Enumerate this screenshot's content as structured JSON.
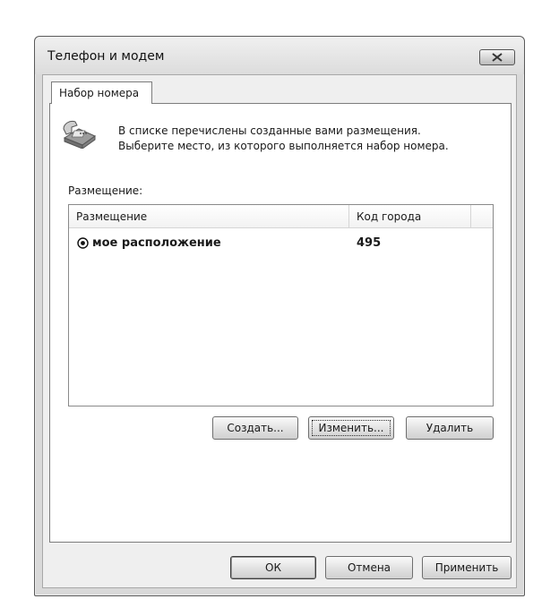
{
  "window": {
    "title": "Телефон и модем"
  },
  "tabs": [
    {
      "label": "Набор номера",
      "active": true
    }
  ],
  "panel": {
    "intro_line1": "В списке перечислены созданные вами размещения.",
    "intro_line2": "Выберите место, из которого выполняется набор номера.",
    "list_label": "Размещение:",
    "columns": [
      "Размещение",
      "Код города"
    ],
    "rows": [
      {
        "name": "мое расположение",
        "code": "495",
        "selected": true
      }
    ],
    "buttons": {
      "create": "Создать...",
      "edit": "Изменить...",
      "delete": "Удалить"
    }
  },
  "footer": {
    "ok": "ОК",
    "cancel": "Отмена",
    "apply": "Применить"
  },
  "icons": {
    "close": "close-icon",
    "phone": "telephone-icon",
    "radio": "radio-selected-icon"
  }
}
